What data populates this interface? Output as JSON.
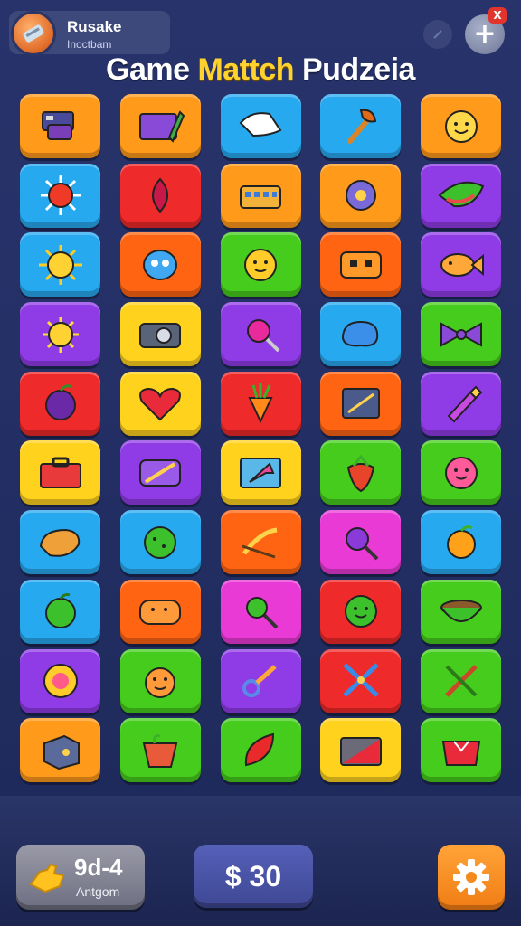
{
  "header": {
    "profile_name": "Rusake",
    "profile_subtitle": "Inoctbam",
    "add_label": "+",
    "close_label": "X",
    "title_parts": [
      "Game",
      "Mattch",
      "Pudzeia"
    ]
  },
  "colors": {
    "orange": "#ff9a1a",
    "blue": "#27a9f0",
    "purple": "#8f3ce6",
    "yellow": "#ffd21e",
    "red": "#ef2a2a",
    "green": "#46cc1c",
    "pink": "#e93ad6",
    "deep_orange": "#ff6412"
  },
  "grid": {
    "rows": [
      [
        {
          "color": "orange",
          "icon": "gadget"
        },
        {
          "color": "orange",
          "icon": "gift-box"
        },
        {
          "color": "blue",
          "icon": "cloth"
        },
        {
          "color": "blue",
          "icon": "axe"
        },
        {
          "color": "orange",
          "icon": "smiley-face"
        }
      ],
      [
        {
          "color": "blue",
          "icon": "red-sun"
        },
        {
          "color": "red",
          "icon": "berry"
        },
        {
          "color": "orange",
          "icon": "basket"
        },
        {
          "color": "orange",
          "icon": "gear"
        },
        {
          "color": "purple",
          "icon": "melon-slice"
        }
      ],
      [
        {
          "color": "blue",
          "icon": "sun-face"
        },
        {
          "color": "deep_orange",
          "icon": "blue-creature"
        },
        {
          "color": "green",
          "icon": "yellow-face"
        },
        {
          "color": "deep_orange",
          "icon": "robot-face"
        },
        {
          "color": "purple",
          "icon": "fish"
        }
      ],
      [
        {
          "color": "purple",
          "icon": "sun"
        },
        {
          "color": "yellow",
          "icon": "camera"
        },
        {
          "color": "purple",
          "icon": "lollipop"
        },
        {
          "color": "blue",
          "icon": "blue-blob"
        },
        {
          "color": "green",
          "icon": "bow"
        }
      ],
      [
        {
          "color": "red",
          "icon": "plum"
        },
        {
          "color": "yellow",
          "icon": "heart"
        },
        {
          "color": "red",
          "icon": "carrot"
        },
        {
          "color": "deep_orange",
          "icon": "tablet"
        },
        {
          "color": "purple",
          "icon": "lipstick"
        }
      ],
      [
        {
          "color": "yellow",
          "icon": "toolbox"
        },
        {
          "color": "purple",
          "icon": "pencil-case"
        },
        {
          "color": "yellow",
          "icon": "tablet-arrow"
        },
        {
          "color": "green",
          "icon": "strawberry"
        },
        {
          "color": "green",
          "icon": "pink-face"
        }
      ],
      [
        {
          "color": "blue",
          "icon": "bread"
        },
        {
          "color": "blue",
          "icon": "green-cookie"
        },
        {
          "color": "deep_orange",
          "icon": "bow-arrow"
        },
        {
          "color": "pink",
          "icon": "purple-lollipop"
        },
        {
          "color": "blue",
          "icon": "orange"
        }
      ],
      [
        {
          "color": "blue",
          "icon": "apple"
        },
        {
          "color": "deep_orange",
          "icon": "orange-face"
        },
        {
          "color": "pink",
          "icon": "green-lollipop"
        },
        {
          "color": "red",
          "icon": "green-face"
        },
        {
          "color": "green",
          "icon": "bowl"
        }
      ],
      [
        {
          "color": "purple",
          "icon": "sun-badge"
        },
        {
          "color": "green",
          "icon": "monkey-face"
        },
        {
          "color": "purple",
          "icon": "key"
        },
        {
          "color": "red",
          "icon": "crossed-swords"
        },
        {
          "color": "green",
          "icon": "crossed-tools"
        }
      ],
      [
        {
          "color": "orange",
          "icon": "cube"
        },
        {
          "color": "green",
          "icon": "flower-pot"
        },
        {
          "color": "green",
          "icon": "leaf"
        },
        {
          "color": "yellow",
          "icon": "envelope"
        },
        {
          "color": "green",
          "icon": "red-basket"
        }
      ]
    ]
  },
  "bottom": {
    "coins_value": "9d-4",
    "coins_label": "Antgom",
    "money_label": "$ 30"
  }
}
